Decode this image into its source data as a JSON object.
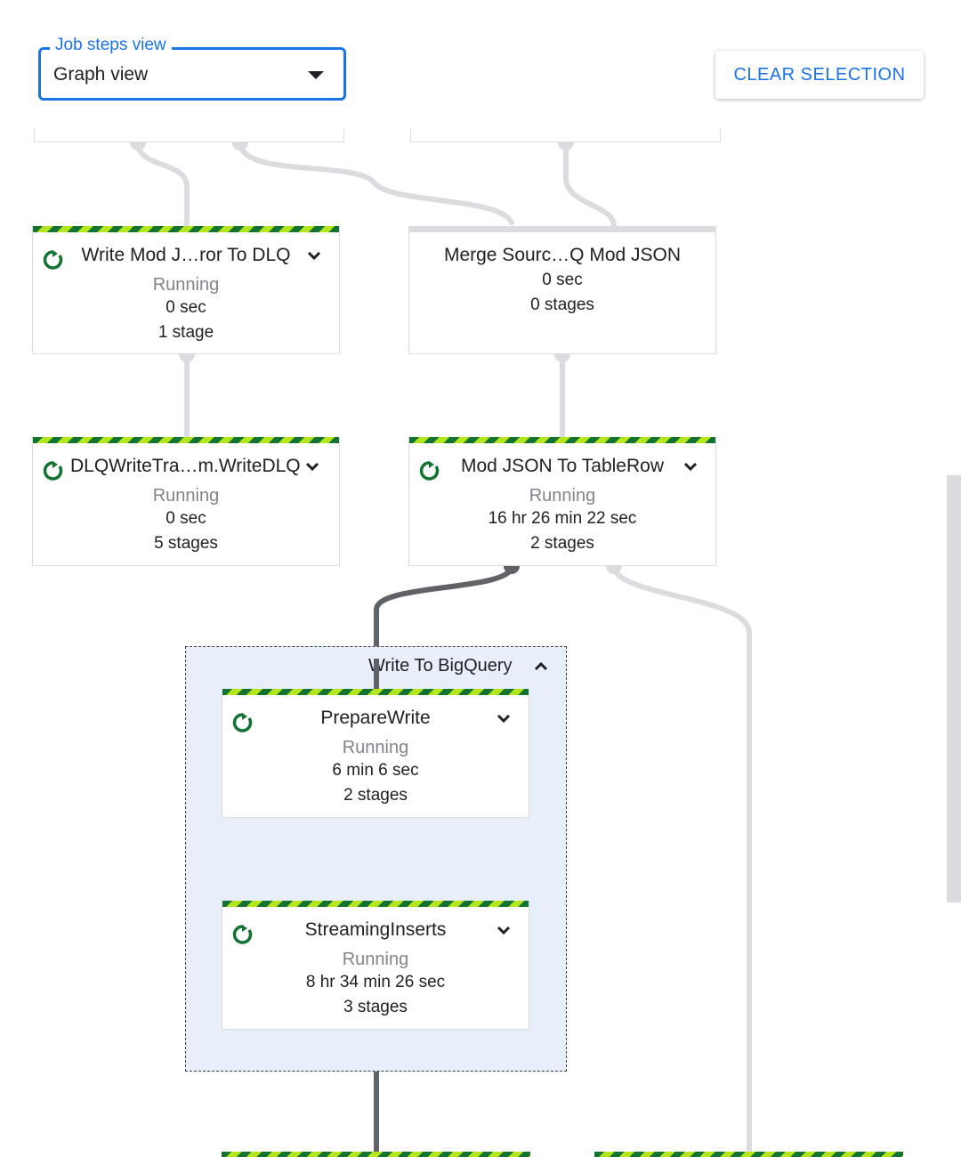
{
  "view_select": {
    "label": "Job steps view",
    "value": "Graph view"
  },
  "clear_selection": "CLEAR SELECTION",
  "colors": {
    "accent": "#1a73e8",
    "running_dark": "#137333",
    "running_light": "#b5e61d",
    "group_bg": "#e8eefa"
  },
  "nodes": [
    {
      "title": "Write Mod J…ror To DLQ",
      "status": "Running",
      "duration": "0 sec",
      "stages": "1 stage"
    },
    {
      "title": "Merge Sourc…Q Mod JSON",
      "duration": "0 sec",
      "stages": "0 stages"
    },
    {
      "title": "DLQWriteTra…m.WriteDLQ",
      "status": "Running",
      "duration": "0 sec",
      "stages": "5 stages"
    },
    {
      "title": "Mod JSON To TableRow",
      "status": "Running",
      "duration": "16 hr 26 min 22 sec",
      "stages": "2 stages"
    }
  ],
  "group": {
    "title": "Write To BigQuery",
    "nodes": [
      {
        "title": "PrepareWrite",
        "status": "Running",
        "duration": "6 min 6 sec",
        "stages": "2 stages"
      },
      {
        "title": "StreamingInserts",
        "status": "Running",
        "duration": "8 hr 34 min 26 sec",
        "stages": "3 stages"
      }
    ]
  }
}
